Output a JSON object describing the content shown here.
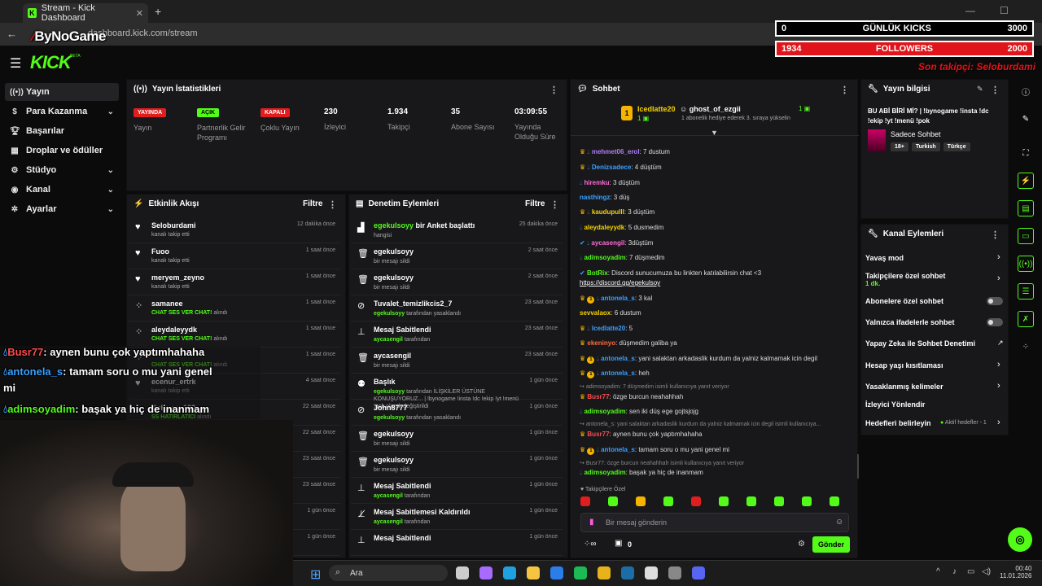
{
  "browser": {
    "tab_title": "Stream - Kick Dashboard",
    "url": "dashboard.kick.com/stream",
    "watermark": "ByNoGame"
  },
  "overlay": {
    "kicks_left": "0",
    "kicks_label": "GÜNLÜK KICKS",
    "kicks_right": "3000",
    "followers_left": "1934",
    "followers_label": "FOLLOWERS",
    "followers_right": "2000",
    "last_follower": "Son takipçi: Seloburdami"
  },
  "logo": {
    "text": "KICK",
    "beta": "BETA"
  },
  "sidebar": {
    "items": [
      {
        "label": "Yayın",
        "icon": "broadcast-icon"
      },
      {
        "label": "Para Kazanma",
        "icon": "dollar-icon"
      },
      {
        "label": "Başarılar",
        "icon": "trophy-icon"
      },
      {
        "label": "Droplar ve ödüller",
        "icon": "gift-icon"
      },
      {
        "label": "Stüdyo",
        "icon": "sliders-icon"
      },
      {
        "label": "Kanal",
        "icon": "user-icon"
      },
      {
        "label": "Ayarlar",
        "icon": "gear-icon"
      }
    ]
  },
  "stats": {
    "title": "Yayın İstatistikleri",
    "live_badge": "YAYINDA",
    "live_label": "Yayın",
    "partner_badge": "AÇIK",
    "partner_label": "Partnerlik Gelir Programı",
    "multi_badge": "KAPALI",
    "multi_label": "Çoklu Yayın",
    "viewers_value": "230",
    "viewers_label": "İzleyici",
    "followers_value": "1.934",
    "followers_label": "Takipçi",
    "subs_value": "35",
    "subs_label": "Abone Sayısı",
    "uptime_value": "03:09:55",
    "uptime_label": "Yayında Olduğu Süre"
  },
  "activity": {
    "title": "Etkinlik Akışı",
    "filter": "Filtre",
    "items": [
      {
        "name": "Seloburdami",
        "sub": "kanalı takip etti",
        "time": "12 dakika önce"
      },
      {
        "name": "Fuoo",
        "sub": "kanalı takip etti",
        "time": "1 saat önce"
      },
      {
        "name": "meryem_zeyno",
        "sub": "kanalı takip etti",
        "time": "1 saat önce"
      },
      {
        "name": "samanee",
        "sub_hl": "CHAT SES VER CHAT!",
        "sub": "alındı",
        "time": "1 saat önce"
      },
      {
        "name": "aleydaleyydk",
        "sub_hl": "CHAT SES VER CHAT!",
        "sub": "alındı",
        "time": "1 saat önce"
      },
      {
        "name": "",
        "sub_hl": "CHAT SES VER CHAT!",
        "sub": "alındı",
        "time": "1 saat önce"
      },
      {
        "name": "ecenur_ertrk",
        "sub": "kanalı takip etti",
        "time": "4 saat önce"
      },
      {
        "name": "Kehrman123",
        "sub_hl": "SS HATIRLATICI",
        "sub": "alındı",
        "time": "22 saat önce"
      }
    ],
    "extra_times": [
      "22 saat önce",
      "23 saat önce",
      "23 saat önce",
      "1 gün önce",
      "1 gün önce"
    ]
  },
  "moderation": {
    "title": "Denetim Eylemleri",
    "filter": "Filtre",
    "items": [
      {
        "name": "egekulsoyy",
        "rest": "bir Anket başlattı",
        "sub": "hangisi",
        "time": "25 dakika önce",
        "icon": "poll-icon"
      },
      {
        "name": "egekulsoyy",
        "sub": "bir mesajı sildi",
        "time": "2 saat önce",
        "icon": "trash-icon"
      },
      {
        "name": "egekulsoyy",
        "sub": "bir mesajı sildi",
        "time": "2 saat önce",
        "icon": "trash-icon"
      },
      {
        "name": "Tuvalet_temizlikcis2_7",
        "sub_user": "egekulsoyy",
        "sub": "tarafından yasaklandı",
        "time": "23 saat önce",
        "icon": "ban-icon"
      },
      {
        "name": "Mesaj Sabitlendi",
        "sub_user": "aycasengil",
        "sub": "tarafından",
        "time": "23 saat önce",
        "icon": "pin-icon"
      },
      {
        "name": "aycasengil",
        "sub": "bir mesajı sildi",
        "time": "23 saat önce",
        "icon": "trash-icon"
      },
      {
        "name": "Başlık",
        "sub_user": "egekulsoyy",
        "sub": "tarafından İLİŞKİLER ÜSTÜNE KONUŞUYORUZ... | !bynogame !insta !dc !ekip !yt !menü !pok olarak değiştirildi",
        "time": "1 gün önce",
        "icon": "user-edit-icon"
      },
      {
        "name": "John8777",
        "sub_user": "egekulsoyy",
        "sub": "tarafından yasaklandı",
        "time": "1 gün önce",
        "icon": "ban-icon"
      },
      {
        "name": "egekulsoyy",
        "sub": "bir mesajı sildi",
        "time": "1 gün önce",
        "icon": "trash-icon"
      },
      {
        "name": "egekulsoyy",
        "sub": "bir mesajı sildi",
        "time": "1 gün önce",
        "icon": "trash-icon"
      },
      {
        "name": "Mesaj Sabitlendi",
        "sub_user": "aycasengil",
        "sub": "tarafından",
        "time": "1 gün önce",
        "icon": "pin-icon"
      },
      {
        "name": "Mesaj Sabitlemesi Kaldırıldı",
        "sub_user": "aycasengil",
        "sub": "tarafından",
        "time": "1 gün önce",
        "icon": "unpin-icon"
      },
      {
        "name": "Mesaj Sabitlendi",
        "sub": "",
        "time": "1 gün önce",
        "icon": "pin-icon"
      }
    ]
  },
  "chat": {
    "title": "Sohbet",
    "gift_user": "Icedlatte20",
    "gift_count": "1",
    "gift_target": "ghost_of_ezgii",
    "gift_target_count": "1",
    "gift_text": "1 abonelik hediye ederek 3. sıraya yükselin",
    "messages": [
      {
        "user": "mehmet06_erol",
        "color": "#b07cff",
        "text": ": 7 dustum",
        "b": "cd"
      },
      {
        "user": "Denizsadece",
        "color": "#3aa0ff",
        "text": ": 4 düştüm",
        "b": "cd"
      },
      {
        "user": "hiremku",
        "color": "#ff6ad5",
        "text": ": 3 düştüm",
        "b": "d"
      },
      {
        "user": "nasthingz",
        "color": "#3aa0ff",
        "text": ": 3 düş",
        "b": ""
      },
      {
        "user": "kaudupulll",
        "color": "#f5d300",
        "text": ": 3 düştüm",
        "b": "cd"
      },
      {
        "user": "aleydaleyydk",
        "color": "#f5d300",
        "text": ": 5 dusmedim",
        "b": "d"
      },
      {
        "user": "aycasengil",
        "color": "#ff6ad5",
        "text": ": 3düştüm",
        "b": "xd"
      },
      {
        "user": "adimsoyadim",
        "color": "#53fc18",
        "text": ": 7 düşmedim",
        "b": "d"
      },
      {
        "user": "BotRix",
        "color": "#53fc18",
        "text": ": Discord sunucumuza bu linkten katılabilirsin chat <3",
        "b": "x"
      },
      {
        "user": "",
        "color": "#fff",
        "text": "https://discord.gg/egekulsoy",
        "b": "",
        "link": true
      },
      {
        "user": "antonela_s",
        "color": "#3aa0ff",
        "text": ": 3 kal",
        "b": "cod"
      },
      {
        "user": "sevvalaox",
        "color": "#f5d300",
        "text": ": 6 dustum",
        "b": ""
      },
      {
        "user": "Icedlatte20",
        "color": "#3aa0ff",
        "text": ": 5",
        "b": "cd"
      },
      {
        "user": "ekeninyo",
        "color": "#ff6a3a",
        "text": ": düşmedim galiba ya",
        "b": "c"
      },
      {
        "user": "antonela_s",
        "color": "#3aa0ff",
        "text": ": yani salaktan arkadaslik kurdum da yalniz kalmamak icin degil",
        "b": "cod"
      },
      {
        "user": "antonela_s",
        "color": "#3aa0ff",
        "text": ": heh",
        "b": "cod"
      },
      {
        "user": "",
        "color": "#888",
        "text": "adimsoyadim: 7 düşmedim isimli kullanıcıya yanıt veriyor",
        "b": "",
        "reply": true
      },
      {
        "user": "Busr77",
        "color": "#ff4d4d",
        "text": ": özge burcun neahahhah",
        "b": "c"
      },
      {
        "user": "adimsoyadim",
        "color": "#53fc18",
        "text": ": sen iki düş ege gojtsjojg",
        "b": "d"
      },
      {
        "user": "",
        "color": "#888",
        "text": "antonela_s: yani salaktan arkadaslik kurdum da yalniz kalmamak icin degil isimli kullanıcıya...",
        "b": "",
        "reply": true
      },
      {
        "user": "Busr77",
        "color": "#ff4d4d",
        "text": ": aynen bunu çok yaptımhahaha",
        "b": "c"
      },
      {
        "user": "antonela_s",
        "color": "#3aa0ff",
        "text": ": tamam soru o mu yani genel mi",
        "b": "cod"
      },
      {
        "user": "",
        "color": "#888",
        "text": "Busr77: özge burcun neahahhah isimli kullanıcıya yanıt veriyor",
        "b": "",
        "reply": true
      },
      {
        "user": "adimsoyadim",
        "color": "#53fc18",
        "text": ": başak ya hiç de inanmam",
        "b": "d"
      }
    ],
    "emote_header": "Takipçilere Özel",
    "input_placeholder": "Bir mesaj gönderin",
    "points": "0",
    "send_label": "Gönder"
  },
  "stream_info": {
    "title": "Yayın bilgisi",
    "stream_title": "BU ABİ BİRİ Mİ? | !bynogame !insta !dc !ekip !yt !menü !pok",
    "category": "Sadece Sohbet",
    "tags": [
      "18+",
      "Turkish",
      "Türkçe"
    ]
  },
  "channel_actions": {
    "title": "Kanal Eylemleri",
    "slow_mode": "Yavaş mod",
    "followers_only": "Takipçilere özel sohbet",
    "followers_only_value": "1 dk.",
    "subs_only": "Abonelere özel sohbet",
    "emotes_only": "Yalnızca ifadelerle sohbet",
    "ai_mod": "Yapay Zeka ile Sohbet Denetimi",
    "age_limit": "Hesap yaşı kısıtlaması",
    "banned_words": "Yasaklanmış kelimeler",
    "viewer_redirect": "İzleyici Yönlendir",
    "goals": "Hedefleri belirleyin",
    "goals_status": "Aktif hedefler - 1"
  },
  "webcam_chat": [
    {
      "user": "Busr77",
      "text": ": aynen bunu çok yaptımhahaha",
      "color": "#ff4d4d"
    },
    {
      "user": "antonela_s",
      "text": ": tamam soru o mu yani genel",
      "color": "#3aa0ff"
    },
    {
      "user": "",
      "text": "mi",
      "color": "#fff"
    },
    {
      "user": "adimsoyadim",
      "text": ": başak ya hiç de inanmam",
      "color": "#53fc18"
    }
  ],
  "taskbar": {
    "search": "Ara",
    "time": "00:40",
    "date": "11.01.2026"
  }
}
